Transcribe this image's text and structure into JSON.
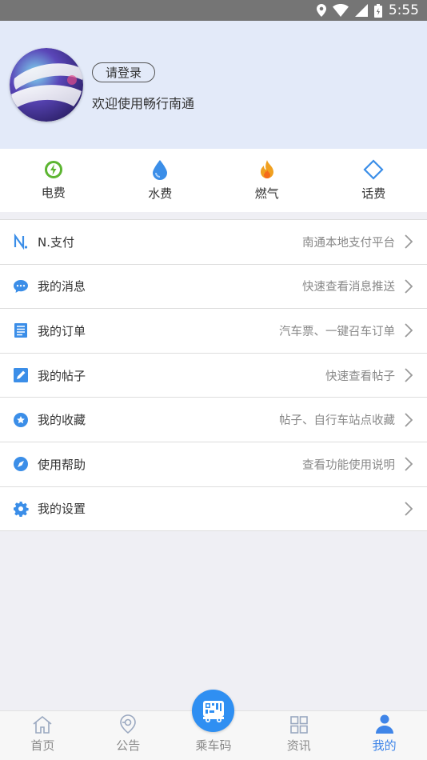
{
  "status_bar": {
    "time": "5:55"
  },
  "profile": {
    "login_label": "请登录",
    "welcome_text": "欢迎使用畅行南通"
  },
  "quick_actions": [
    {
      "label": "电费",
      "icon": "electricity-icon",
      "color": "#5cb531"
    },
    {
      "label": "水费",
      "icon": "water-drop-icon",
      "color": "#3b8ee8"
    },
    {
      "label": "燃气",
      "icon": "flame-icon",
      "color": "#f0a020"
    },
    {
      "label": "话费",
      "icon": "phone-bill-icon",
      "color": "#3b8ee8"
    }
  ],
  "menu": [
    {
      "title": "N.支付",
      "desc": "南通本地支付平台",
      "icon": "n-pay-icon"
    },
    {
      "title": "我的消息",
      "desc": "快速查看消息推送",
      "icon": "message-icon"
    },
    {
      "title": "我的订单",
      "desc": "汽车票、一键召车订单",
      "icon": "order-icon"
    },
    {
      "title": "我的帖子",
      "desc": "快速查看帖子",
      "icon": "post-icon"
    },
    {
      "title": "我的收藏",
      "desc": "帖子、自行车站点收藏",
      "icon": "favorite-icon"
    },
    {
      "title": "使用帮助",
      "desc": "查看功能使用说明",
      "icon": "help-compass-icon"
    },
    {
      "title": "我的设置",
      "desc": "",
      "icon": "gear-icon"
    }
  ],
  "tab_bar": {
    "tabs": [
      {
        "label": "首页",
        "icon": "home-icon"
      },
      {
        "label": "公告",
        "icon": "notice-icon"
      },
      {
        "label": "乘车码",
        "icon": "bus-qr-icon"
      },
      {
        "label": "资讯",
        "icon": "news-grid-icon"
      },
      {
        "label": "我的",
        "icon": "person-icon"
      }
    ],
    "active_tab": "我的",
    "accent_color": "#3f85e8"
  }
}
